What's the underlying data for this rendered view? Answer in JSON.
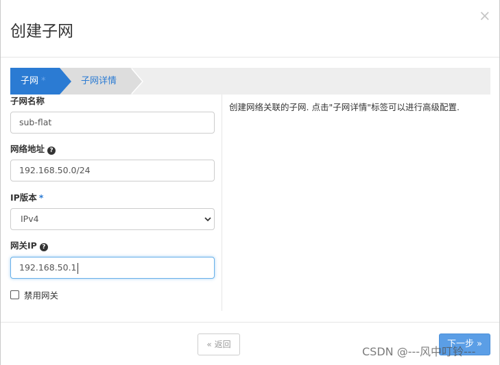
{
  "dialog": {
    "title": "创建子网",
    "close_label": "×"
  },
  "wizard": {
    "steps": [
      {
        "label": "子网",
        "required_mark": "*"
      },
      {
        "label": "子网详情"
      }
    ]
  },
  "form": {
    "subnet_name": {
      "label": "子网名称",
      "value": "sub-flat"
    },
    "network_address": {
      "label": "网络地址",
      "value": "192.168.50.0/24",
      "help": "?"
    },
    "ip_version": {
      "label": "IP版本",
      "required_mark": "*",
      "selected": "IPv4"
    },
    "gateway_ip": {
      "label": "网关IP",
      "value": "192.168.50.1",
      "help": "?"
    },
    "disable_gateway": {
      "label": "禁用网关",
      "checked": false
    }
  },
  "help_text": "创建网络关联的子网. 点击\"子网详情\"标签可以进行高级配置.",
  "footer": {
    "back_label": "« 返回",
    "next_label": "下一步 »"
  },
  "watermark": "CSDN @---风中叮铃---",
  "colors": {
    "primary": "#2b7bd3",
    "button_primary": "#5b9ee6",
    "focus_border": "#66afe9"
  }
}
